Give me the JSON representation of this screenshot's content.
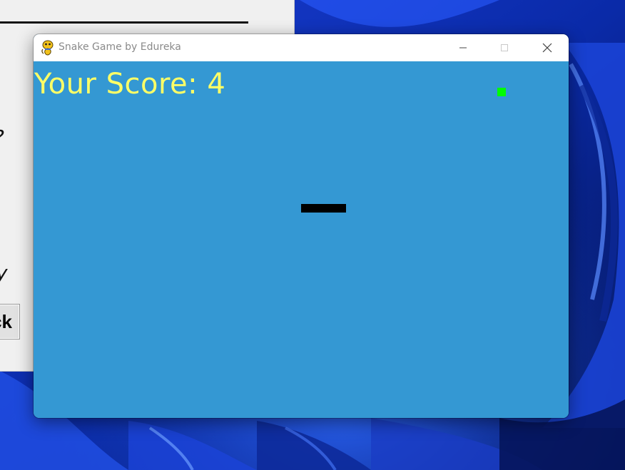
{
  "window": {
    "title": "Snake Game by Edureka",
    "icon": "pygame-snake-icon"
  },
  "game": {
    "score_label": "Your Score: 4",
    "score": 4,
    "colors": {
      "background": "#3498d3",
      "score_text": "#ffff66",
      "snake": "#000000",
      "food": "#00ff00"
    }
  },
  "background_app": {
    "text_1": "?",
    "text_2": "y",
    "button_label": "ck"
  }
}
